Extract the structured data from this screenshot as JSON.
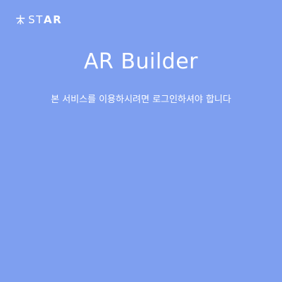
{
  "brand": {
    "name_light": "ST",
    "name_bold": "AR",
    "logo_icon": "star-logo-icon"
  },
  "header": {
    "title": "AR Builder"
  },
  "notice": {
    "message": "본 서비스를 이용하시려면 로그인하셔야 합니다"
  },
  "colors": {
    "background": "#7e9ff0",
    "text": "#ffffff"
  }
}
